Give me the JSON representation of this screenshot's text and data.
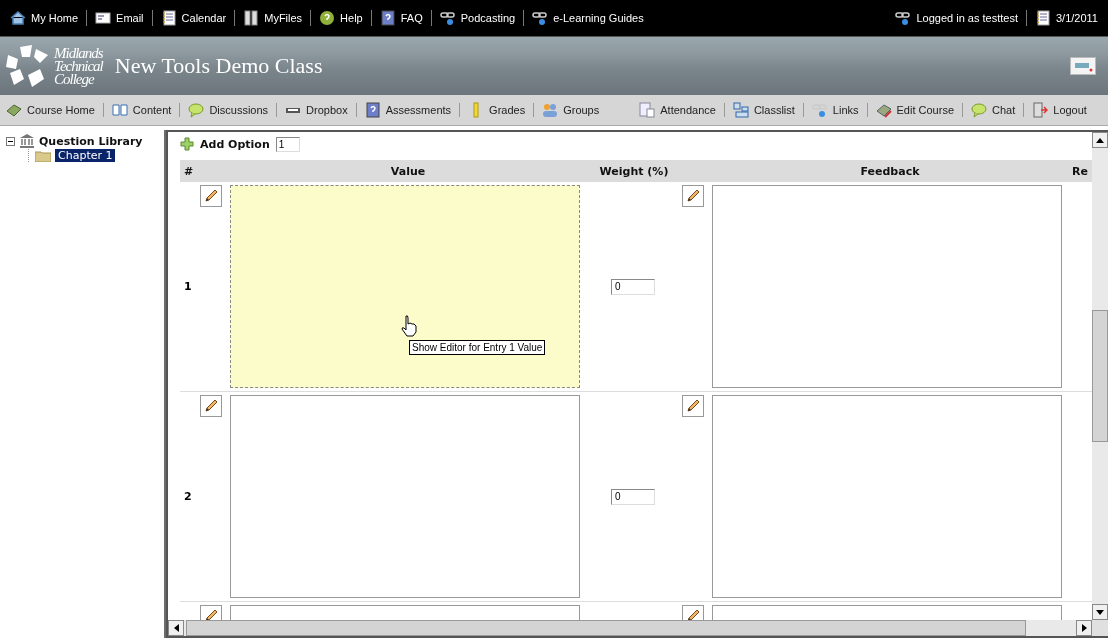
{
  "top_bar": {
    "links": [
      {
        "kind": "home",
        "label": "My Home"
      },
      {
        "kind": "email",
        "label": "Email"
      },
      {
        "kind": "calendar",
        "label": "Calendar"
      },
      {
        "kind": "files",
        "label": "MyFiles"
      },
      {
        "kind": "help",
        "label": "Help"
      },
      {
        "kind": "faq",
        "label": "FAQ"
      },
      {
        "kind": "link",
        "label": "Podcasting"
      },
      {
        "kind": "link",
        "label": "e-Learning Guides"
      }
    ],
    "user": {
      "kind": "link",
      "label": "Logged in as testtest"
    },
    "date": {
      "kind": "calendar",
      "label": "3/1/2011"
    }
  },
  "banner": {
    "logo_lines": [
      "Midlands",
      "Technical",
      "College"
    ],
    "course_title": "New Tools Demo Class"
  },
  "course_nav": [
    {
      "kind": "book",
      "label": "Course Home"
    },
    {
      "kind": "content",
      "label": "Content"
    },
    {
      "kind": "chat",
      "label": "Discussions"
    },
    {
      "kind": "dropbox",
      "label": "Dropbox"
    },
    {
      "kind": "faq",
      "label": "Assessments"
    },
    {
      "kind": "ruler",
      "label": "Grades"
    },
    {
      "kind": "people",
      "label": "Groups"
    },
    {
      "kind": "sheet",
      "label": "Attendance"
    },
    {
      "kind": "grid",
      "label": "Classlist"
    },
    {
      "kind": "link",
      "label": "Links"
    },
    {
      "kind": "edit",
      "label": "Edit Course"
    },
    {
      "kind": "chat",
      "label": "Chat"
    },
    {
      "kind": "logout",
      "label": "Logout"
    }
  ],
  "tree": {
    "label": "Question Library",
    "expanded": true,
    "children": [
      {
        "label": "Chapter 1",
        "selected": true
      }
    ]
  },
  "editor": {
    "add_option": {
      "label": "Add Option",
      "count": "1"
    },
    "columns": [
      "#",
      "Value",
      "Weight (%)",
      "Feedback",
      "Re"
    ],
    "rows": [
      {
        "number": "1",
        "weight": "0",
        "highlighted": true
      },
      {
        "number": "2",
        "weight": "0",
        "highlighted": false
      },
      {
        "highlighted": false
      }
    ],
    "tooltip": "Show Editor for Entry 1 Value"
  }
}
